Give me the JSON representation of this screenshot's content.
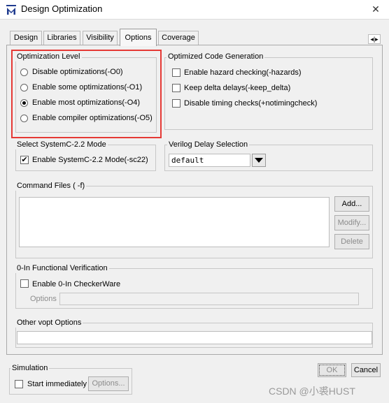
{
  "window": {
    "title": "Design Optimization",
    "close_label": "✕",
    "icon": "modelsim-m-logo-icon"
  },
  "tabs": [
    "Design",
    "Libraries",
    "Visibility",
    "Options",
    "Coverage"
  ],
  "active_tab": "Options",
  "tab_scroll_label": "◂|▸",
  "optimization_level": {
    "legend": "Optimization Level",
    "options": [
      "Disable optimizations(-O0)",
      "Enable some optimizations(-O1)",
      "Enable most optimizations(-O4)",
      "Enable compiler optimizations(-O5)"
    ],
    "selected": "Enable most optimizations(-O4)"
  },
  "optimized_code": {
    "legend": "Optimized Code Generation",
    "options": [
      "Enable hazard checking(-hazards)",
      "Keep delta delays(-keep_delta)",
      "Disable timing checks(+notimingcheck)"
    ]
  },
  "systemc": {
    "legend": "Select SystemC-2.2 Mode",
    "checkbox_label": "Enable SystemC-2.2 Mode(-sc22)",
    "checked": true
  },
  "verilog_delay": {
    "legend": "Verilog Delay Selection",
    "value": "default"
  },
  "command_files": {
    "legend": "Command Files ( -f)",
    "add_label": "Add...",
    "modify_label": "Modify...",
    "delete_label": "Delete"
  },
  "functional_verification": {
    "legend": "0-In Functional Verification",
    "checkbox_label": "Enable 0-In CheckerWare",
    "options_label": "Options"
  },
  "other_vopt": {
    "legend": "Other vopt Options"
  },
  "simulation": {
    "legend": "Simulation",
    "checkbox_label": "Start immediately",
    "options_button": "Options..."
  },
  "footer": {
    "ok_label": "OK",
    "cancel_label": "Cancel"
  },
  "watermark": "CSDN @小裘HUST",
  "colors": {
    "highlight_box": "#e53935",
    "dialog_bg": "#f0f0f0"
  }
}
